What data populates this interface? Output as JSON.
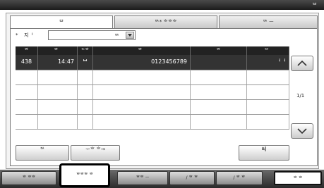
{
  "top": {
    "right_text": "ᄇ"
  },
  "tabs": [
    {
      "label": "ᄇ"
    },
    {
      "label": "ᄡ* ᄒᄒᄒ"
    },
    {
      "label": "ᄡ ᅳ"
    }
  ],
  "filter": {
    "label": "* ᅟ지ᅵ",
    "value": "ᄡ"
  },
  "table": {
    "headers": [
      "ᄇᄒ",
      "ᄇᄒ",
      "ᄃᄒ",
      "ᄇᄒ",
      "ᄇᄒ",
      "ᄇ"
    ],
    "rows": [
      {
        "num": "438",
        "time": "14:47",
        "icon": "ᄇ",
        "phone": "0123456789",
        "c5": "",
        "status": "ᅥᅥ"
      },
      {
        "num": "",
        "time": "",
        "icon": "",
        "phone": "",
        "c5": "",
        "status": ""
      },
      {
        "num": "",
        "time": "",
        "icon": "",
        "phone": "",
        "c5": "",
        "status": ""
      },
      {
        "num": "",
        "time": "",
        "icon": "",
        "phone": "",
        "c5": "",
        "status": ""
      },
      {
        "num": "",
        "time": "",
        "icon": "",
        "phone": "",
        "c5": "",
        "status": ""
      }
    ]
  },
  "pager": {
    "indicator": "1/1"
  },
  "buttons": {
    "left": "ᄡ",
    "mid": "ᅮᄒ\nᄒ→",
    "right": "ᄡᅦ"
  },
  "bottom_tabs": [
    {
      "label": "ᄒ ᄒᄒ"
    },
    {
      "label": "ᄒᄒᄒ ᄒ"
    },
    {
      "label": "ᄒᄒ ᅳ"
    },
    {
      "label": "/ ᄒ ᄒ"
    },
    {
      "label": "/ ᄒ ᄒ"
    },
    {
      "label": "ᄒ ᄒ"
    }
  ]
}
